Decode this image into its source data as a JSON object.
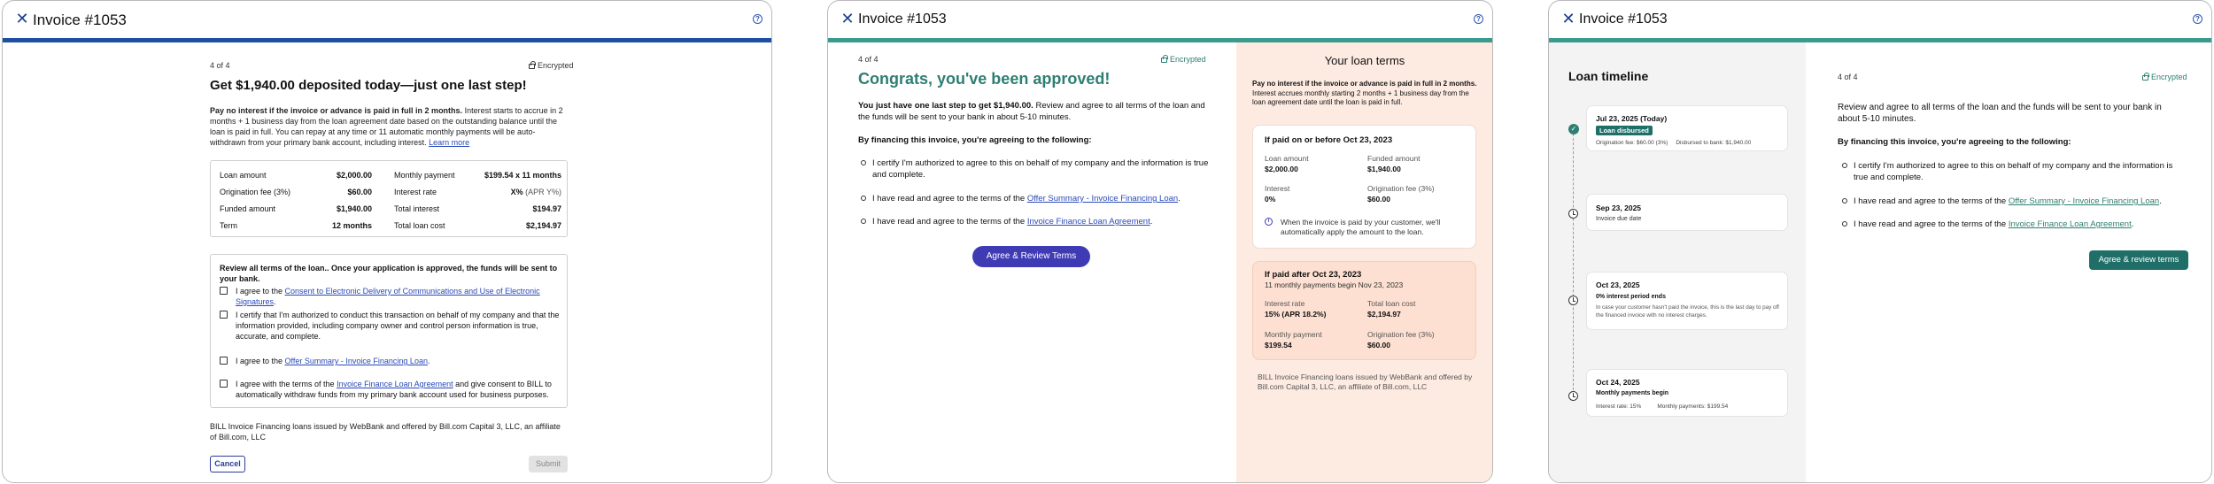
{
  "invoice_title": "Invoice #1053",
  "help_icon": "?",
  "close_icon": "✕",
  "panel1": {
    "step": "4 of 4",
    "encrypted": "Encrypted",
    "heading": "Get $1,940.00 deposited today—just one last step!",
    "intro_bold": "Pay no interest if the invoice or advance is paid in full in 2 months.",
    "intro_rest": " Interest starts to accrue in 2 months + 1 business day from the loan agreement date based on the outstanding balance until the loan is paid in full. You can repay at any time or 11 automatic monthly payments will be auto-withdrawn from your primary bank account, including interest.",
    "learn_more": "Learn more",
    "summary": [
      {
        "label": "Loan amount",
        "value": "$2,000.00",
        "label2": "Monthly payment",
        "value2": "$199.54 x 11 months"
      },
      {
        "label": "Origination fee (3%)",
        "value": "$60.00",
        "label2": "Interest rate",
        "value2_bold": "X%",
        "value2_rest": " (APR Y%)"
      },
      {
        "label": "Funded amount",
        "value": "$1,940.00",
        "label2": "Total interest",
        "value2": "$194.97"
      },
      {
        "label": "Term",
        "value": "12 months",
        "label2": "Total loan cost",
        "value2": "$2,194.97"
      }
    ],
    "review_heading": "Review all terms of the loan.. Once your application is approved, the funds will be sent to your bank.",
    "cb1_pre": "I agree to the ",
    "cb1_link": "Consent to Electronic Delivery of Communications and Use of Electronic Signatures",
    "cb1_post": ".",
    "cb2": "I certify that I'm authorized to conduct this transaction on behalf of my company and that the information provided, including company owner and control person information is true, accurate, and complete.",
    "cb3_pre": "I agree to the ",
    "cb3_link": "Offer Summary - Invoice Financing Loan",
    "cb3_post": ".",
    "cb4_pre": "I agree with the terms of the  ",
    "cb4_link": "Invoice Finance Loan Agreement",
    "cb4_post": " and give consent to BILL to automatically withdraw funds from my primary bank account used for business purposes.",
    "disclaimer": "BILL Invoice Financing loans issued by WebBank and offered by Bill.com Capital 3, LLC, an affiliate of Bill.com, LLC",
    "cancel": "Cancel",
    "submit": "Submit"
  },
  "panel2": {
    "step": "4 of 4",
    "encrypted": "Encrypted",
    "heading": "Congrats, you've been approved!",
    "p1_bold": "You just have one last step to get $1,940.00.",
    "p1_rest": " Review and agree to all terms of the loan and the funds will be sent to your bank in about 5-10 minutes.",
    "p2": "By financing this invoice, you're agreeing to the following:",
    "b1": "I certify I'm authorized to agree to this on behalf of my company and the information is true and complete.",
    "b2_pre": "I have read and agree to the terms of the ",
    "b2_link": "Offer Summary - Invoice Financing Loan",
    "b2_post": ".",
    "b3_pre": "I have read and agree to the terms of the ",
    "b3_link": "Invoice Finance Loan Agreement",
    "b3_post": ".",
    "button": "Agree & Review Terms",
    "terms_title": "Your loan terms",
    "terms_bold": "Pay no interest if the invoice or advance is paid in full in 2 months.",
    "terms_rest": " Interest accrues monthly starting 2 months + 1 business day from the loan agreement date until the loan is paid in full.",
    "card1_title": "If paid on or before Oct 23, 2023",
    "card1": {
      "l1": "Loan amount",
      "v1": "$2,000.00",
      "l2": "Funded amount",
      "v2": "$1,940.00",
      "l3": "Interest",
      "v3": "0%",
      "l4": "Origination fee (3%)",
      "v4": "$60.00"
    },
    "card1_note": "When the invoice is paid by your customer, we'll automatically apply the amount to the loan.",
    "card2_title": "If paid after Oct 23, 2023",
    "card2_sub": "11 monthly payments begin Nov 23, 2023",
    "card2": {
      "l1": "Interest rate",
      "v1": "15% (APR 18.2%)",
      "l2": "Total loan cost",
      "v2": "$2,194.97",
      "l3": "Monthly payment",
      "v3": "$199.54",
      "l4": "Origination fee (3%)",
      "v4": "$60.00"
    },
    "disclaimer": "BILL Invoice Financing loans issued by WebBank and offered by Bill.com Capital 3, LLC, an affiliate of Bill.com, LLC"
  },
  "panel3": {
    "timeline_title": "Loan timeline",
    "events": [
      {
        "date": "Jul 23, 2025 (Today)",
        "badge": "Loan disbursed",
        "detail": "Origination fee: $60.00 (3%)     Disbursed to bank: $1,940.00"
      },
      {
        "date": "Sep 23, 2025",
        "detail": "Invoice due date"
      },
      {
        "date": "Oct 23, 2025",
        "detail": "0% interest period ends",
        "note": "In case your customer hasn't paid the invoice, this is the last day to pay off the financed invoice with no interest charges."
      },
      {
        "date": "Oct 24, 2025",
        "detail": "Monthly payments begin",
        "note": "Interest rate: 15%          Monthly payments: $199.54"
      }
    ],
    "step": "4 of 4",
    "encrypted": "Encrypted",
    "p1": "Review and agree to all terms of the loan and the funds will be sent to your bank in about 5-10 minutes.",
    "p2": "By financing this invoice, you're agreeing to the following:",
    "b1": "I certify I'm authorized to agree to this on behalf of my company and the information is true and complete.",
    "b2_pre": "I have read and agree to the terms of the ",
    "b2_link": "Offer Summary - Invoice Financing Loan",
    "b2_post": ".",
    "b3_pre": "I have read and agree to the terms of the ",
    "b3_link": "Invoice Finance Loan Agreement",
    "b3_post": ".",
    "button": "Agree & review terms"
  },
  "colors": {
    "navy_bar": "#1f4fa0",
    "teal_bar": "#3a9a8d",
    "approved_green": "#2e7f72",
    "purple_button": "#3e3bb4",
    "peach_panel": "#fdebe2",
    "teal_button": "#1f6e68"
  }
}
